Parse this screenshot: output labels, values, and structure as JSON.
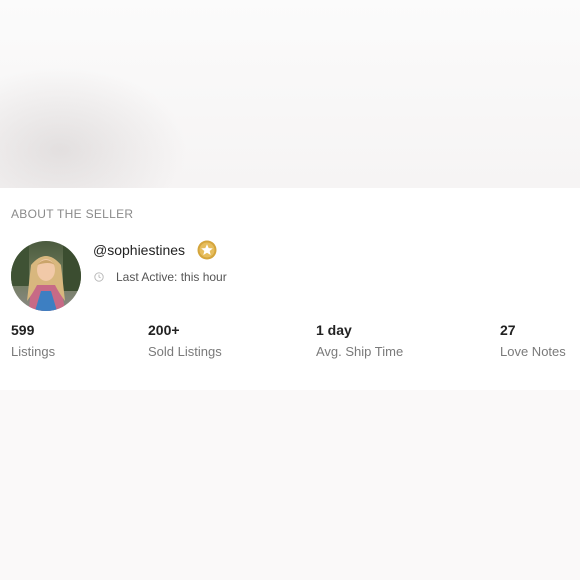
{
  "seller": {
    "section_title": "ABOUT THE SELLER",
    "username": "@sophiestines",
    "last_active": "Last Active: this hour",
    "badge_icon": "gold-star-badge-icon",
    "clock_icon": "clock-icon"
  },
  "stats": [
    {
      "value": "599",
      "label": "Listings"
    },
    {
      "value": "200+",
      "label": "Sold Listings"
    },
    {
      "value": "1 day",
      "label": "Avg. Ship Time"
    },
    {
      "value": "27",
      "label": "Love Notes"
    }
  ],
  "colors": {
    "badge_gold": "#d4a53c",
    "text_dark": "#222222",
    "text_muted": "#7a7a7a"
  }
}
